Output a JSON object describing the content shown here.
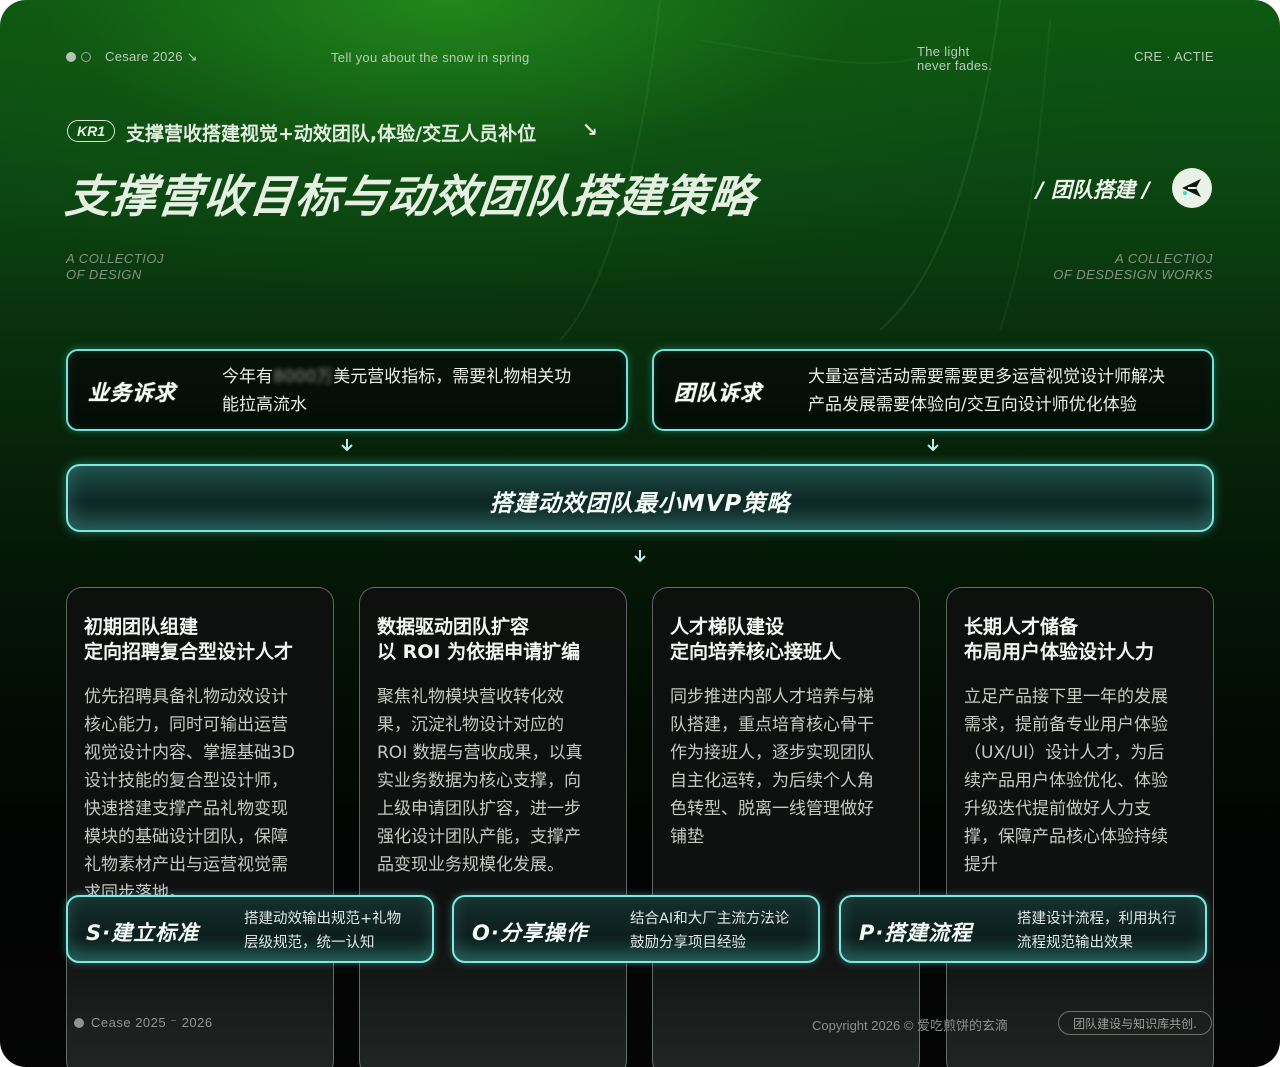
{
  "header": {
    "brand": "Cesare 2026",
    "brand_arrow": "↘",
    "tagline": "Tell you about the snow in spring",
    "quote_line1": "The light",
    "quote_line2": "never fades.",
    "right_label": "CRE · ACTIE"
  },
  "kr": {
    "badge": "KR1",
    "text": "支撑营收搭建视觉+动效团队,体验/交互人员补位",
    "arrow": "↘"
  },
  "title": "支撑营收目标与动效团队搭建策略",
  "tag": {
    "label": "/ 团队搭建 /",
    "icon": "plane-icon"
  },
  "collection_left": {
    "line1": "A COLLECTIOJ",
    "line2": "OF DESIGN"
  },
  "collection_right": {
    "line1": "A COLLECTIOJ",
    "line2": "OF DESDESIGN WORKS"
  },
  "needs": [
    {
      "label": "业务诉求",
      "line1_pre": "今年有",
      "line1_blur": "8000万",
      "line1_post": "美元营收指标，需要礼物相关功",
      "line2": "能拉高流水"
    },
    {
      "label": "团队诉求",
      "line1": "大量运营活动需要需要更多运营视觉设计师解决",
      "line2": "产品发展需要体验向/交互向设计师优化体验"
    }
  ],
  "mvp": "搭建动效团队最小MVP策略",
  "columns": [
    {
      "title1": "初期团队组建",
      "title2": "定向招聘复合型设计人才",
      "body": [
        "优先招聘具备礼物动效设计",
        "核心能力，同时可输出运营",
        "视觉设计内容、掌握基础3D",
        "设计技能的复合型设计师，",
        "快速搭建支撑产品礼物变现",
        "模块的基础设计团队，保障",
        "礼物素材产出与运营视觉需",
        "求同步落地。"
      ]
    },
    {
      "title1": "数据驱动团队扩容",
      "title2": "以 ROI 为依据申请扩编",
      "body": [
        "聚焦礼物模块营收转化效",
        "果，沉淀礼物设计对应的",
        "ROI 数据与营收成果，以真",
        "实业务数据为核心支撑，向",
        "上级申请团队扩容，进一步",
        "强化设计团队产能，支撑产",
        "品变现业务规模化发展。"
      ]
    },
    {
      "title1": "人才梯队建设",
      "title2": "定向培养核心接班人",
      "body": [
        "同步推进内部人才培养与梯",
        "队搭建，重点培育核心骨干",
        "作为接班人，逐步实现团队",
        "自主化运转，为后续个人角",
        "色转型、脱离一线管理做好",
        "铺垫"
      ]
    },
    {
      "title1": "长期人才储备",
      "title2": "布局用户体验设计人力",
      "body": [
        "立足产品接下里一年的发展",
        "需求，提前备专业用户体验",
        "（UX/UI）设计人才，为后",
        "续产品用户体验优化、体验",
        "升级迭代提前做好人力支",
        "撑，保障产品核心体验持续",
        "提升"
      ]
    }
  ],
  "bottom_cards": [
    {
      "label": "S·建立标准",
      "line1": "搭建动效输出规范+礼物",
      "line2": "层级规范，统一认知"
    },
    {
      "label": "O·分享操作",
      "line1": "结合AI和大厂主流方法论",
      "line2": "鼓励分享项目经验"
    },
    {
      "label": "P·搭建流程",
      "line1": "搭建设计流程，利用执行",
      "line2": "流程规范输出效果"
    }
  ],
  "footer": {
    "left": "Cease 2025 ⁻ 2026",
    "right": "Copyright 2026 © 爱吃煎饼的玄滴",
    "pill": "团队建设与知识库共创."
  },
  "colors": {
    "accent_cyan": "#7fe9e1",
    "green_top": "#0d5a12",
    "dark_bottom": "#050505"
  }
}
